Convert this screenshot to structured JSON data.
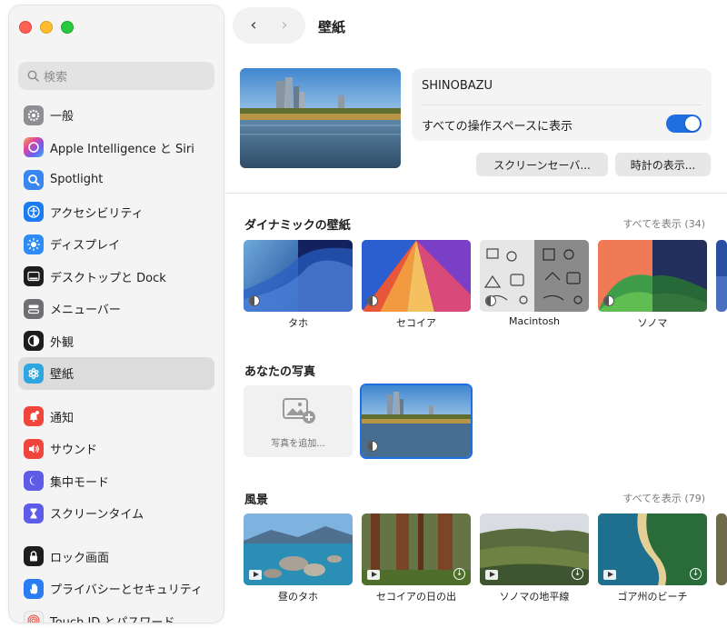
{
  "window": {
    "title": "壁紙",
    "back_glyph": "‹",
    "forward_glyph": "›"
  },
  "sidebar": {
    "search_placeholder": "検索",
    "groups": [
      [
        {
          "label": "一般",
          "icon": "gear-icon",
          "color": "#8e8e93"
        },
        {
          "label": "Apple Intelligence と Siri",
          "icon": "apple-intelligence-icon",
          "color": "#d45bd0"
        },
        {
          "label": "Spotlight",
          "icon": "spotlight-icon",
          "color": "#3a86f0"
        },
        {
          "label": "アクセシビリティ",
          "icon": "accessibility-icon",
          "color": "#1a7cf0"
        },
        {
          "label": "ディスプレイ",
          "icon": "display-brightness-icon",
          "color": "#2c8cf4"
        },
        {
          "label": "デスクトップと Dock",
          "icon": "dock-icon",
          "color": "#1d1d1f"
        },
        {
          "label": "メニューバー",
          "icon": "menubar-icon",
          "color": "#6e6e73"
        },
        {
          "label": "外観",
          "icon": "appearance-icon",
          "color": "#1d1d1f"
        },
        {
          "label": "壁紙",
          "icon": "wallpaper-icon",
          "color": "#2fa6e0",
          "active": true
        }
      ],
      [
        {
          "label": "通知",
          "icon": "notifications-icon",
          "color": "#f0453a"
        },
        {
          "label": "サウンド",
          "icon": "sound-icon",
          "color": "#f0453a"
        },
        {
          "label": "集中モード",
          "icon": "focus-moon-icon",
          "color": "#5e5ce6"
        },
        {
          "label": "スクリーンタイム",
          "icon": "screen-time-icon",
          "color": "#5e5ce6"
        }
      ],
      [
        {
          "label": "ロック画面",
          "icon": "lock-icon",
          "color": "#1d1d1f"
        },
        {
          "label": "プライバシーとセキュリティ",
          "icon": "privacy-hand-icon",
          "color": "#2c7cf2"
        },
        {
          "label": "Touch ID とパスワード",
          "icon": "touch-id-icon",
          "color": "#f0f0f0"
        }
      ]
    ]
  },
  "current": {
    "name": "SHINOBAZU",
    "show_all_spaces_label": "すべての操作スペースに表示",
    "show_all_spaces_on": true,
    "screensaver_button": "スクリーンセーバ...",
    "clock_button": "時計の表示..."
  },
  "dynamic": {
    "title": "ダイナミックの壁紙",
    "show_all": "すべてを表示 (34)",
    "items": [
      "タホ",
      "セコイア",
      "Macintosh",
      "ソノマ"
    ]
  },
  "photos": {
    "title": "あなたの写真",
    "add_label": "写真を追加..."
  },
  "landscape": {
    "title": "風景",
    "show_all": "すべてを表示 (79)",
    "items": [
      "昼のタホ",
      "セコイアの日の出",
      "ソノマの地平線",
      "ゴア州のビーチ"
    ]
  },
  "colors": {
    "accent": "#1f6fe0",
    "sidebar_bg": "#f4f4f4",
    "selection_bg": "#dcdcdc"
  }
}
